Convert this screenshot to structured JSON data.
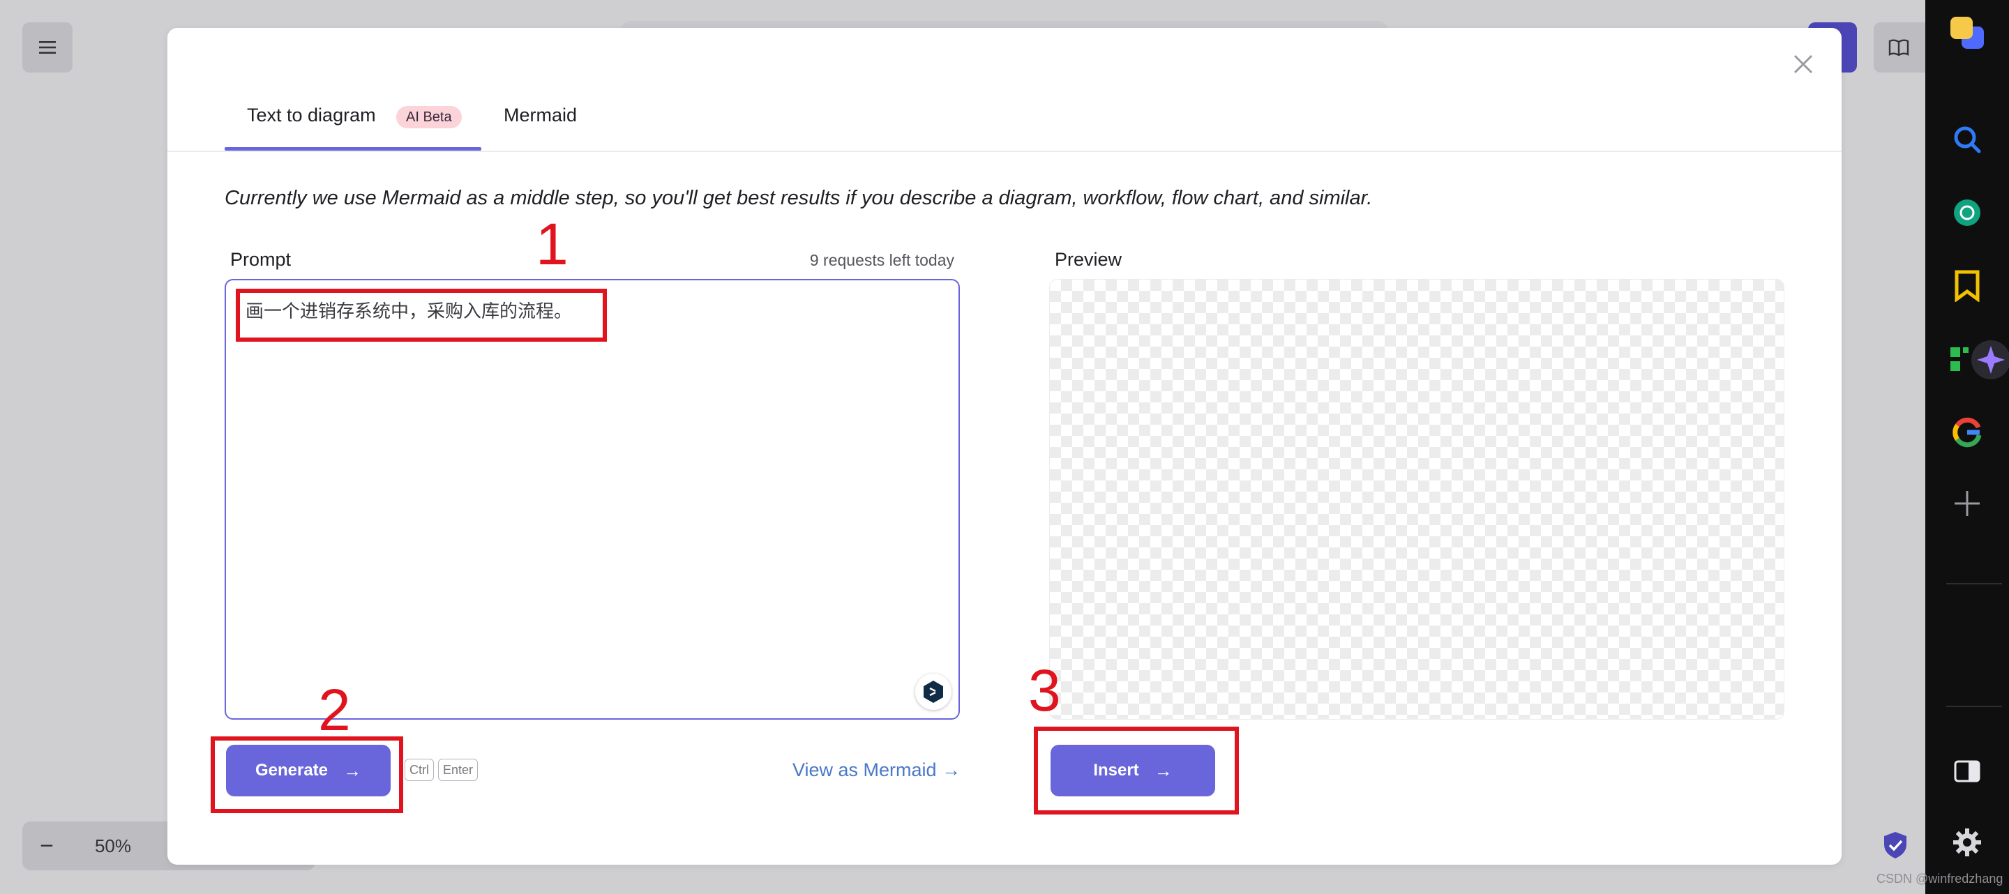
{
  "background": {
    "zoom_minus": "−",
    "zoom_level": "50%"
  },
  "modal": {
    "tabs": [
      {
        "label": "Text to diagram",
        "active": true
      },
      {
        "label": "Mermaid",
        "active": false
      }
    ],
    "badge": "AI Beta",
    "intro": "Currently we use Mermaid as a middle step, so you'll get best results if you describe a diagram, workflow, flow chart, and similar.",
    "prompt": {
      "label": "Prompt",
      "requests_left": "9 requests left today",
      "value": "画一个进销存系统中，采购入库的流程。"
    },
    "preview": {
      "label": "Preview"
    },
    "generate_label": "Generate",
    "shortcut_keys": [
      "Ctrl",
      "Enter"
    ],
    "view_as_mermaid": "View as Mermaid →",
    "insert_label": "Insert",
    "arrow": "→"
  },
  "annotations": {
    "step1": "1",
    "step2": "2",
    "step3": "3"
  },
  "watermark": "CSDN @winfredzhang",
  "colors": {
    "accent": "#6965db",
    "annotation_red": "#e0141e",
    "badge_bg": "#fbd3d8",
    "link": "#4a78c8",
    "sidebar_bg": "#0f0f10"
  },
  "icons": [
    "menu-icon",
    "book-icon",
    "shield-icon",
    "close-icon",
    "deepl-icon",
    "search-icon",
    "chatgpt-icon",
    "bookmark-icon",
    "apps-sparkle-icon",
    "google-icon",
    "plus-icon",
    "split-panel-icon",
    "gear-icon"
  ]
}
